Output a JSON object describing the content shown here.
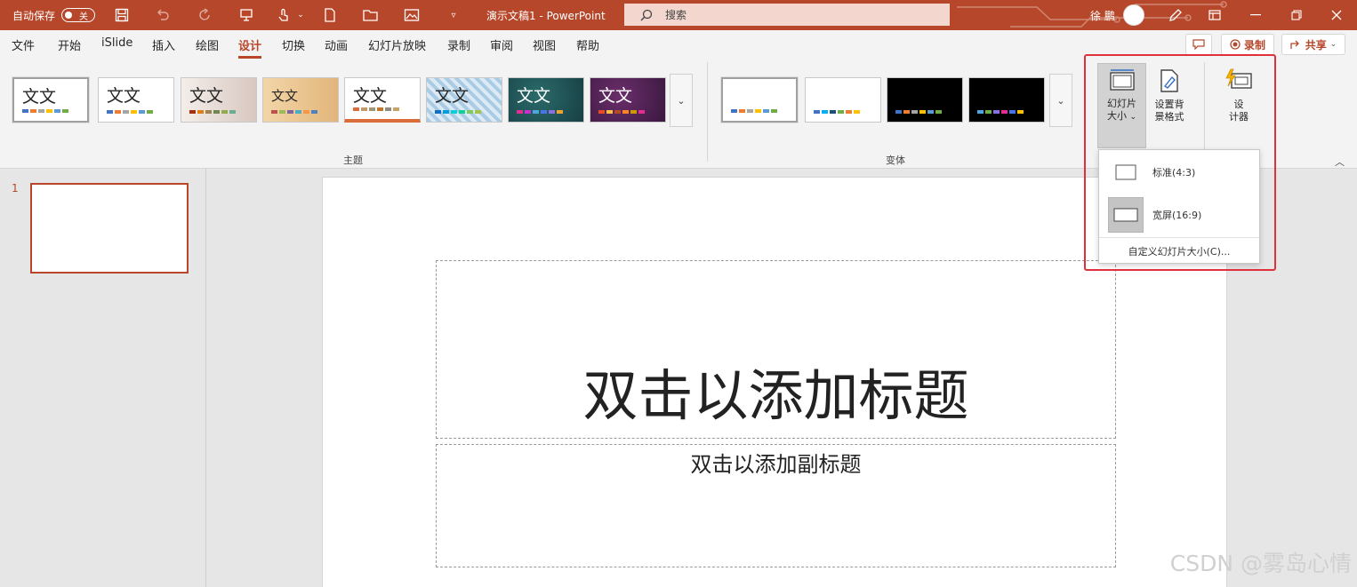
{
  "titlebar": {
    "autosave_label": "自动保存",
    "autosave_state": "关",
    "doc_title": "演示文稿1 - PowerPoint",
    "search_placeholder": "搜索",
    "user_name": "徐 鹏"
  },
  "tabs": [
    "文件",
    "开始",
    "iSlide",
    "插入",
    "绘图",
    "设计",
    "切换",
    "动画",
    "幻灯片放映",
    "录制",
    "审阅",
    "视图",
    "帮助"
  ],
  "active_tab": "设计",
  "tab_actions": {
    "record": "录制",
    "share": "共享"
  },
  "ribbon": {
    "themes_label": "主题",
    "variants_label": "变体",
    "theme_thumb_text": "文文",
    "slide_size_label_1": "幻灯片",
    "slide_size_label_2": "大小",
    "format_bg_label_1": "设置背",
    "format_bg_label_2": "景格式",
    "designer_label_1": "设",
    "designer_label_2": "计器"
  },
  "slide_size_menu": {
    "standard": "标准(4:3)",
    "widescreen": "宽屏(16:9)",
    "custom": "自定义幻灯片大小(C)..."
  },
  "slides": {
    "number": "1"
  },
  "slide": {
    "title_placeholder": "双击以添加标题",
    "subtitle_placeholder": "双击以添加副标题"
  },
  "watermark": "CSDN @雾岛心情",
  "colors": {
    "accent": "#b7472a",
    "highlight_border": "#e0313a"
  }
}
